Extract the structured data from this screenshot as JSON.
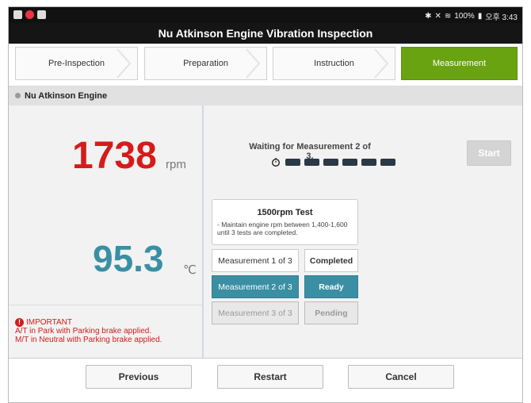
{
  "status_bar": {
    "right_text": "100%",
    "time": "오후 3:43"
  },
  "title": "Nu Atkinson Engine Vibration Inspection",
  "steps": [
    {
      "label": "Pre-Inspection"
    },
    {
      "label": "Preparation"
    },
    {
      "label": "Instruction"
    },
    {
      "label": "Measurement",
      "active": true
    }
  ],
  "section": {
    "label": "Nu Atkinson Engine"
  },
  "readings": {
    "rpm_value": "1738",
    "rpm_unit": "rpm",
    "temp_value": "95.3",
    "temp_unit": "℃"
  },
  "important": {
    "heading": "IMPORTANT",
    "lines": [
      "A/T in Park with Parking brake applied.",
      "M/T in Neutral with Parking brake applied."
    ]
  },
  "measure": {
    "waiting_text": "Waiting for Measurement 2 of 3.",
    "progress_bars": 6,
    "start_label": "Start",
    "test_title": "1500rpm Test",
    "test_desc": "- Maintain engine rpm between 1,400-1,600 until 3 tests are completed.",
    "rows": [
      {
        "label": "Measurement 1 of 3",
        "status": "Completed"
      },
      {
        "label": "Measurement 2 of 3",
        "status": "Ready"
      },
      {
        "label": "Measurement 3 of 3",
        "status": "Pending"
      }
    ]
  },
  "footer": {
    "previous": "Previous",
    "restart": "Restart",
    "cancel": "Cancel"
  },
  "colors": {
    "accent_green": "#6aa312",
    "rpm_red": "#d51b1b",
    "teal": "#3a8fa3"
  }
}
